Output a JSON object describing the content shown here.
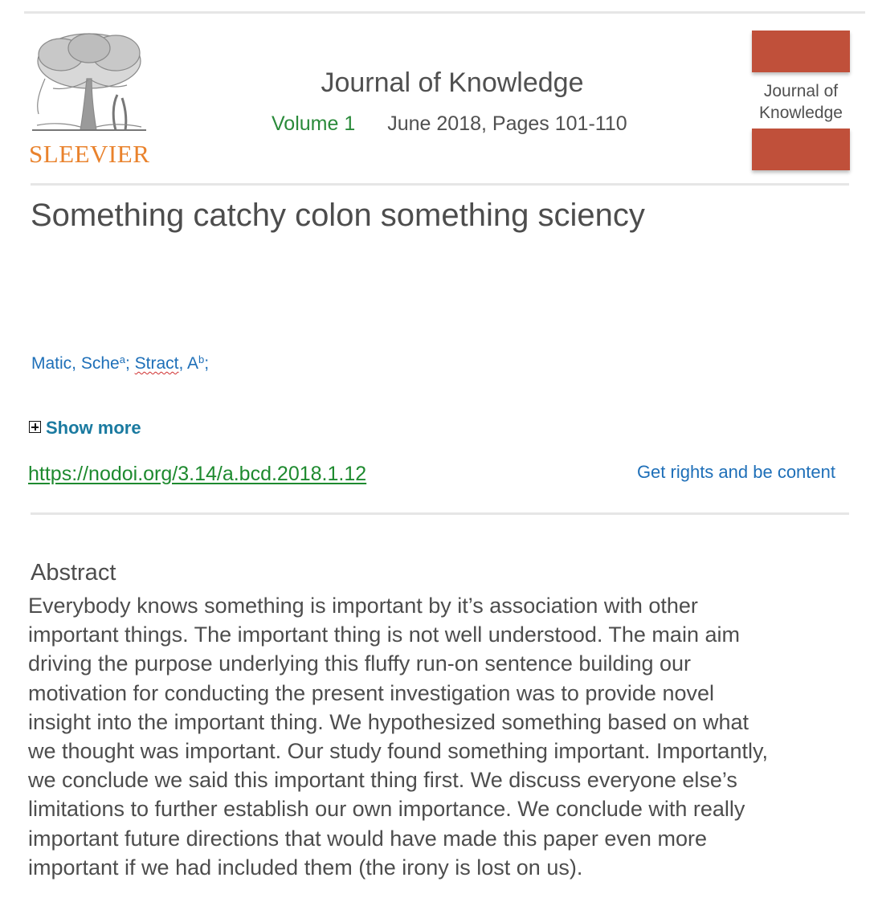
{
  "publisher": {
    "logo_icon": "tree-with-figures-engraving",
    "name": "SLEEVIER"
  },
  "journal": {
    "title": "Journal of Knowledge",
    "volume": "Volume 1",
    "date_pages": "June 2018, Pages 101-110",
    "cover_title_line1": "Journal of",
    "cover_title_line2": "Knowledge"
  },
  "article": {
    "title": "Something catchy colon something sciency",
    "authors": {
      "author1_name": "Matic, Sche",
      "author1_sup": "a",
      "separator1": "; ",
      "author2_surname": "Stract",
      "author2_initial": ", A",
      "author2_sup": "b",
      "separator2": ";"
    },
    "show_more_label": "Show more",
    "doi_link": "https://nodoi.org/3.14/a.bcd.2018.1.12",
    "rights_link": "Get rights and be content"
  },
  "abstract": {
    "heading": "Abstract",
    "lines": [
      "Everybody knows something is important by it’s association with other",
      "important things. The important thing is not well understood. The main aim",
      "driving the purpose underlying this fluffy run-on sentence building our",
      "motivation for conducting the present investigation was to provide novel",
      "insight into the important thing. We hypothesized something based on what",
      "we thought was important. Our study found something important. Importantly,",
      "we conclude we said this important thing first. We discuss everyone else’s",
      "limitations to further establish our own importance. We conclude with really",
      "important future directions that would have made this paper even more",
      "important if we had included them (the irony is lost on us)."
    ]
  },
  "colors": {
    "publisher_orange": "#e9822c",
    "volume_green": "#2a8a3a",
    "link_blue": "#1e6fb8",
    "doi_green": "#1e8a2f",
    "cover_red": "#c0503a"
  }
}
